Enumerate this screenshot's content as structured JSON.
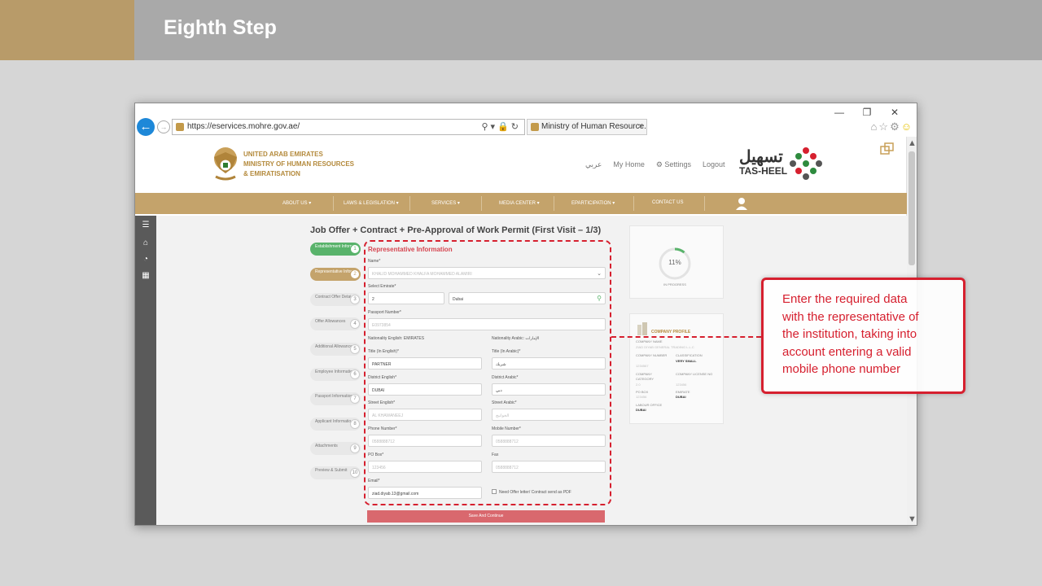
{
  "slide": {
    "title": "Eighth Step"
  },
  "browser": {
    "url": "https://eservices.mohre.gov.ae/",
    "tab_title": "Ministry of Human Resource...",
    "tab_close": "×",
    "win_min": "—",
    "win_restore": "❐",
    "win_close": "✕"
  },
  "site": {
    "ministry_lines": [
      "UNITED ARAB EMIRATES",
      "MINISTRY OF HUMAN RESOURCES",
      "& EMIRATISATION"
    ],
    "top_links": {
      "arabic": "عربي",
      "home": "My Home",
      "settings": "⚙ Settings",
      "logout": "Logout"
    },
    "brand_ar": "تسهيل",
    "brand_en": "TAS-HEEL",
    "nav": [
      "ABOUT US ▾",
      "LAWS & LEGISLATION ▾",
      "SERVICES ▾",
      "MEDIA CENTER ▾",
      "EPARTICIPATION ▾",
      "CONTACT US"
    ]
  },
  "page": {
    "title": "Job Offer + Contract + Pre-Approval of Work Permit (First Visit – 1/3)",
    "steps": [
      {
        "label": "Establishment Inform...",
        "num": "1",
        "state": "done"
      },
      {
        "label": "Representative Infor...",
        "num": "2",
        "state": "active"
      },
      {
        "label": "Contract Offer Detai...",
        "num": "3",
        "state": "todo"
      },
      {
        "label": "Offer Allowances",
        "num": "4",
        "state": "todo"
      },
      {
        "label": "Additional Allowances",
        "num": "5",
        "state": "todo"
      },
      {
        "label": "Employee Information",
        "num": "6",
        "state": "todo"
      },
      {
        "label": "Passport Information",
        "num": "7",
        "state": "todo"
      },
      {
        "label": "Applicant Informatio...",
        "num": "8",
        "state": "todo"
      },
      {
        "label": "Attachments",
        "num": "9",
        "state": "todo"
      },
      {
        "label": "Preview & Submit",
        "num": "10",
        "state": "todo"
      }
    ],
    "form": {
      "heading": "Representative Information",
      "name_label": "Name*",
      "name_value": "KHALID MOHAMMED KHALFA MOHAMMED ALAMIRI",
      "emirate_label": "Select Emirate*",
      "emirate_code": "2",
      "emirate_value": "Dubai",
      "passport_label": "Passport Number*",
      "passport_value": "E0973854",
      "nat_en": "Nationality English: EMIRATES",
      "nat_ar": "Nationality Arabic: الإمارات",
      "title_en_label": "Title (In English)*",
      "title_en_value": "PARTNER",
      "title_ar_label": "Title (In Arabic)*",
      "title_ar_value": "شريك",
      "district_en_label": "District English*",
      "district_en_value": "DUBAI",
      "district_ar_label": "District Arabic*",
      "district_ar_value": "دبي",
      "street_en_label": "Street English*",
      "street_en_value": "AL KHAWANEEJ",
      "street_ar_label": "Street Arabic*",
      "street_ar_value": "الخوانيج",
      "phone_label": "Phone Number*",
      "phone_value": "0588888712",
      "mobile_label": "Mobile Number*",
      "mobile_value": "0588888712",
      "pobox_label": "PO Box*",
      "pobox_value": "123456",
      "fax_label": "Fax",
      "fax_value": "0588888712",
      "email_label": "Email*",
      "email_value": "ziad.diyab.13@gmail.com",
      "pdf_label": "Need Offer letter/ Contract send as PDF",
      "save_label": "Save And Continue"
    },
    "progress": {
      "value": 11,
      "text": "11%",
      "label": "IN PROGRESS"
    },
    "company": {
      "title": "COMPANY PROFILE",
      "name_label": "COMPANY NAME",
      "name_value": "ZIAD DIYAB GENERAL TRADING L.L.C",
      "number_label": "COMPANY NUMBER",
      "number_value": "1234567",
      "classification_label": "CLASSIFICATION",
      "classification_value": "VERY SMALL",
      "category_label": "COMPANY CATEGORY",
      "category_value": "2.0",
      "license_label": "COMPANY LICENSE NO",
      "license_value": "123456",
      "pobox_label": "PO BOX",
      "pobox_value": "123456",
      "emirate_label": "EMIRATE",
      "emirate_value": "DUBAI",
      "office_label": "LABOUR OFFICE",
      "office_value": "DUBAI"
    }
  },
  "callout": {
    "lines": [
      "Enter the required data",
      "with the representative of",
      "the institution, taking into",
      "account entering a valid",
      "mobile phone number"
    ]
  },
  "colors": {
    "gold": "#c4a36b",
    "accent_red": "#d6202f",
    "progress_green": "#59b36b"
  }
}
